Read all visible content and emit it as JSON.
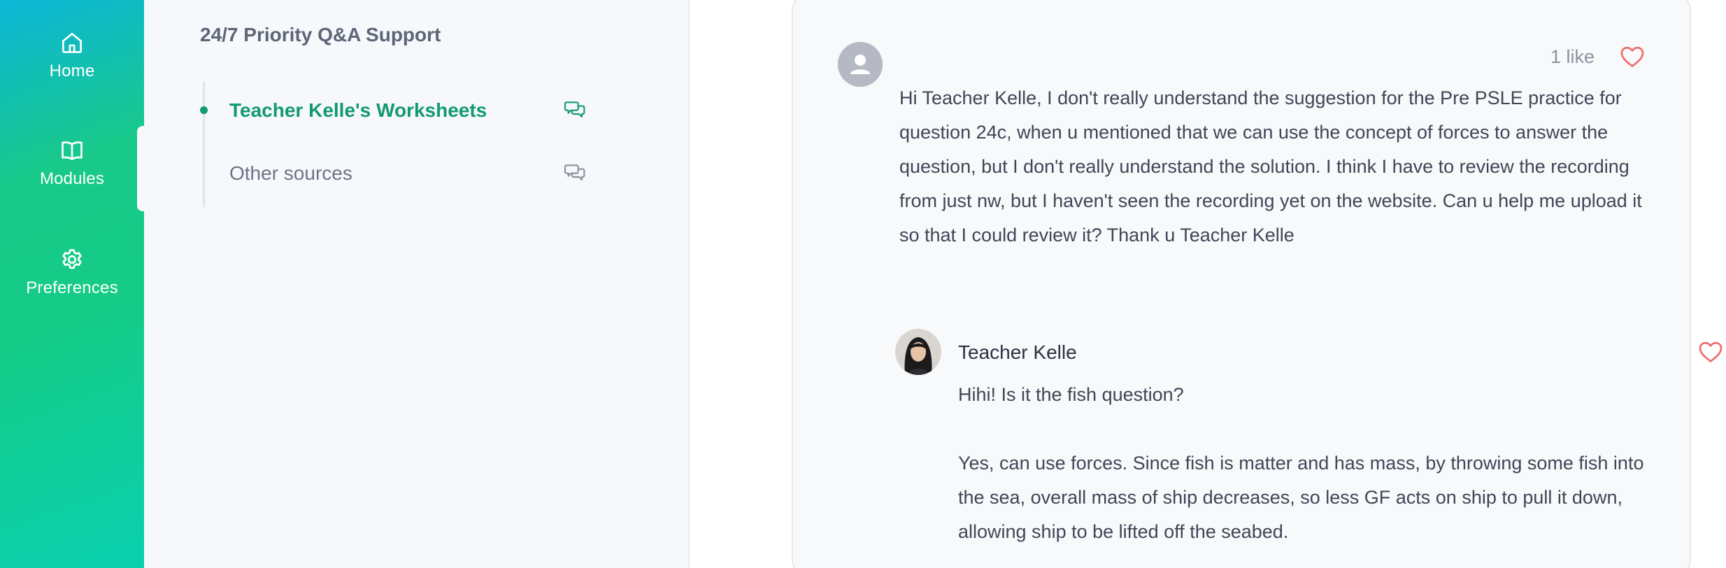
{
  "nav": {
    "items": [
      {
        "label": "Home",
        "icon": "home-icon"
      },
      {
        "label": "Modules",
        "icon": "book-icon"
      },
      {
        "label": "Preferences",
        "icon": "gear-icon"
      }
    ],
    "active_index": 1
  },
  "sidebar": {
    "title": "24/7 Priority Q&A Support",
    "items": [
      {
        "label": "Teacher Kelle's Worksheets",
        "active": true,
        "icon": "chat-bubbles-icon"
      },
      {
        "label": "Other sources",
        "active": false,
        "icon": "chat-bubbles-icon"
      }
    ]
  },
  "post": {
    "likes_label": "1 like",
    "body": "Hi Teacher Kelle, I don't really understand the suggestion for the Pre PSLE practice for question 24c, when u mentioned that we can use the concept of forces to answer the question, but I don't really understand the solution. I think I have to review the recording from just nw, but I haven't seen the recording yet on the website. Can u help me upload it so that I could review it? Thank u Teacher Kelle"
  },
  "reply": {
    "author": "Teacher Kelle",
    "paragraph_1": "Hihi! Is it the fish question?",
    "paragraph_2": "Yes, can use forces. Since fish is matter and has mass, by throwing some fish into the sea, overall mass of ship decreases, so less GF acts on ship to pull it down, allowing ship to be lifted off the seabed."
  },
  "colors": {
    "brand_green": "#129a70",
    "heart": "#ef6b6b",
    "nav_gradient_top": "#0cb6d9",
    "nav_gradient_mid": "#14cc86"
  }
}
